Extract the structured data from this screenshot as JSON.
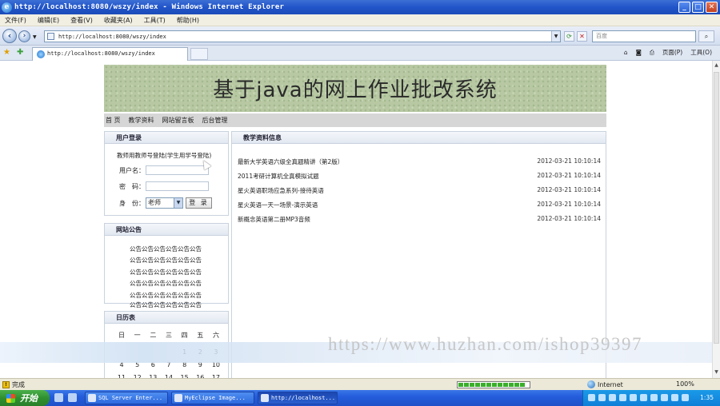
{
  "window": {
    "title": "http://localhost:8080/wszy/index - Windows Internet Explorer",
    "buttons": [
      "_",
      "□",
      "✕"
    ]
  },
  "menu": [
    "文件(F)",
    "编辑(E)",
    "查看(V)",
    "收藏夹(A)",
    "工具(T)",
    "帮助(H)"
  ],
  "address": {
    "url": "http://localhost:8080/wszy/index",
    "search_placeholder": "百度"
  },
  "tab": {
    "label": "http://localhost:8080/wszy/index"
  },
  "toolbar_right": {
    "page": "页面(P)",
    "tools": "工具(O)"
  },
  "site": {
    "banner_title": "基于java的网上作业批改系统",
    "nav": [
      "首 页",
      "教学资料",
      "网站留言板",
      "后台管理"
    ]
  },
  "login": {
    "title": "用户登录",
    "hint": "教师用教师号登陆(学生用学号登陆)",
    "username_label": "用户名：",
    "password_label": "密　码：",
    "role_label": "身　份：",
    "role_value": "老师",
    "login_button": "登 录"
  },
  "notice": {
    "title": "网站公告",
    "lines": [
      "公告公告公告公告公告公告",
      "公告公告公告公告公告公告",
      "公告公告公告公告公告公告",
      "公告公告公告公告公告公告",
      "公告公告公告公告公告公告",
      "公告公告公告公告公告公告"
    ]
  },
  "calendar": {
    "title": "日历表",
    "weekdays": [
      "日",
      "一",
      "二",
      "三",
      "四",
      "五",
      "六"
    ],
    "rows": [
      [
        "",
        "",
        "",
        "",
        "1",
        "2",
        "3"
      ],
      [
        "4",
        "5",
        "6",
        "7",
        "8",
        "9",
        "10"
      ],
      [
        "11",
        "12",
        "13",
        "14",
        "15",
        "16",
        "17"
      ]
    ]
  },
  "materials": {
    "title": "教学资料信息",
    "items": [
      {
        "title": "最新大学英语六级全真题精讲（第2版）",
        "date": "2012-03-21 10:10:14"
      },
      {
        "title": "2011考研计算机全真模拟试题",
        "date": "2012-03-21 10:10:14"
      },
      {
        "title": "星火英语职场应急系列-接待英语",
        "date": "2012-03-21 10:10:14"
      },
      {
        "title": "星火英语一天一场景-演示英语",
        "date": "2012-03-21 10:10:14"
      },
      {
        "title": "新概念英语第二册MP3音频",
        "date": "2012-03-21 10:10:14"
      }
    ]
  },
  "watermark": "https://www.huzhan.com/ishop39397",
  "status": {
    "text": "完成",
    "zone": "Internet",
    "zoom": "100%"
  },
  "taskbar": {
    "start": "开始",
    "buttons": [
      "SQL Server Enter...",
      "MyEclipse Image...",
      "http://localhost..."
    ],
    "clock": "1:35"
  }
}
